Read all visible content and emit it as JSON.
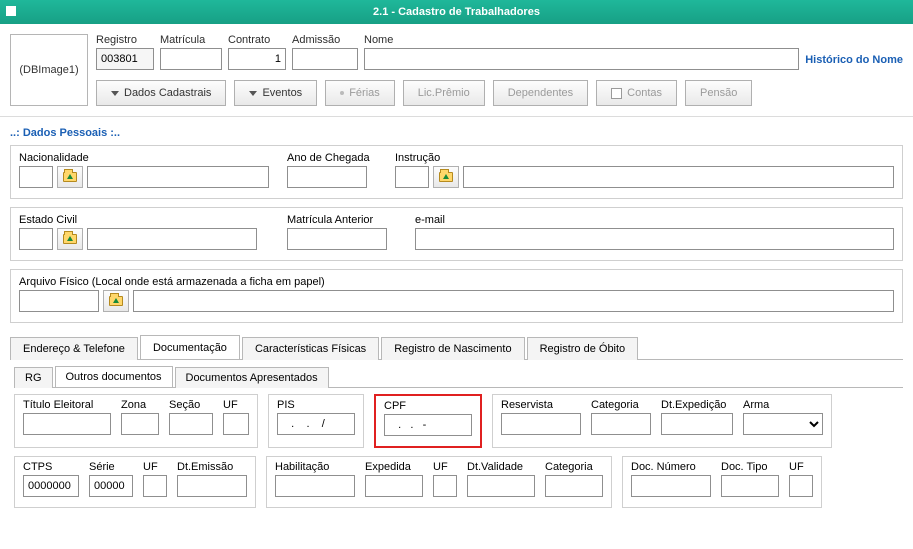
{
  "window": {
    "title": "2.1 - Cadastro de Trabalhadores",
    "dbimage": "(DBImage1)"
  },
  "header": {
    "registro_label": "Registro",
    "registro_value": "003801",
    "matricula_label": "Matrícula",
    "matricula_value": "",
    "contrato_label": "Contrato",
    "contrato_value": "1",
    "admissao_label": "Admissão",
    "admissao_value": "",
    "nome_label": "Nome",
    "nome_value": "",
    "historico_link": "Histórico do Nome",
    "btn_dados": "Dados Cadastrais",
    "btn_eventos": "Eventos",
    "btn_ferias": "Férias",
    "btn_lic": "Lic.Prêmio",
    "btn_dep": "Dependentes",
    "btn_contas": "Contas",
    "btn_pensao": "Pensão"
  },
  "section_title": "..: Dados Pessoais :..",
  "pessoais": {
    "nacionalidade": "Nacionalidade",
    "ano_chegada": "Ano de Chegada",
    "instrucao": "Instrução",
    "estado_civil": "Estado Civil",
    "matricula_anterior": "Matrícula Anterior",
    "email": "e-mail",
    "arquivo_fisico": "Arquivo Físico (Local onde está armazenada a ficha em papel)"
  },
  "tabs": {
    "t1": "Endereço & Telefone",
    "t2": "Documentação",
    "t3": "Características Físicas",
    "t4": "Registro de Nascimento",
    "t5": "Registro de Óbito"
  },
  "subtabs": {
    "s1": "RG",
    "s2": "Outros documentos",
    "s3": "Documentos Apresentados"
  },
  "docs": {
    "titulo": "Título Eleitoral",
    "zona": "Zona",
    "secao": "Seção",
    "uf": "UF",
    "pis": "PIS",
    "pis_mask": "   .    .    /",
    "cpf": "CPF",
    "cpf_mask": "   .   .   -",
    "reservista": "Reservista",
    "categoria": "Categoria",
    "dt_exped": "Dt.Expedição",
    "arma": "Arma",
    "ctps": "CTPS",
    "ctps_value": "0000000",
    "serie": "Série",
    "serie_value": "00000",
    "uf2": "UF",
    "dt_emissao": "Dt.Emissão",
    "habilitacao": "Habilitação",
    "expedida": "Expedida",
    "uf3": "UF",
    "dt_validade": "Dt.Validade",
    "categoria2": "Categoria",
    "doc_numero": "Doc. Número",
    "doc_tipo": "Doc. Tipo",
    "uf4": "UF"
  }
}
